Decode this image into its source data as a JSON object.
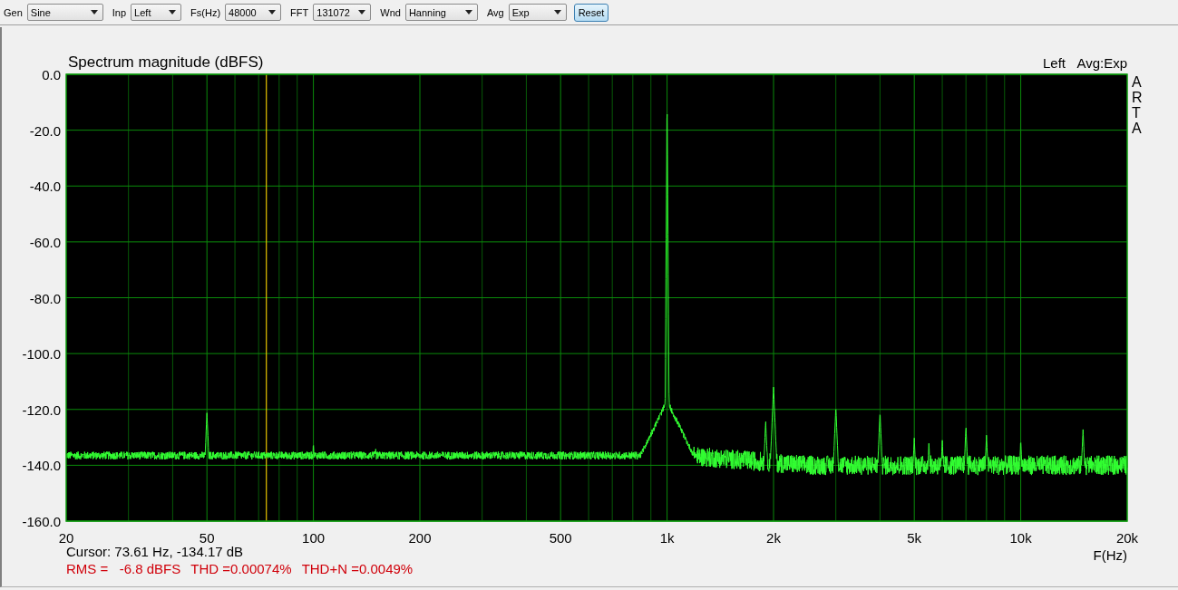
{
  "toolbar": [
    {
      "label": "Gen",
      "value": "Sine"
    },
    {
      "label": "Inp",
      "value": "Left"
    },
    {
      "label": "Fs(Hz)",
      "value": "48000"
    },
    {
      "label": "FFT",
      "value": "131072"
    },
    {
      "label": "Wnd",
      "value": "Hanning"
    },
    {
      "label": "Avg",
      "value": "Exp"
    }
  ],
  "reset_button": "Reset",
  "chart": {
    "title": "Spectrum magnitude (dBFS)",
    "channel": "Left",
    "averaging": "Avg:Exp",
    "side_letters": [
      "A",
      "R",
      "T",
      "A"
    ],
    "yticks": [
      "0.0",
      "-20.0",
      "-40.0",
      "-60.0",
      "-80.0",
      "-100.0",
      "-120.0",
      "-140.0",
      "-160.0"
    ],
    "xticks": [
      "20",
      "50",
      "100",
      "200",
      "500",
      "1k",
      "2k",
      "5k",
      "10k",
      "20k"
    ],
    "xlabel": "F(Hz)",
    "cursor_readout": "Cursor: 73.61 Hz, -134.17 dB",
    "measurements": [
      "RMS =   -6.8 dBFS",
      "THD =0.00074%",
      "THD+N =0.0049%"
    ]
  }
}
